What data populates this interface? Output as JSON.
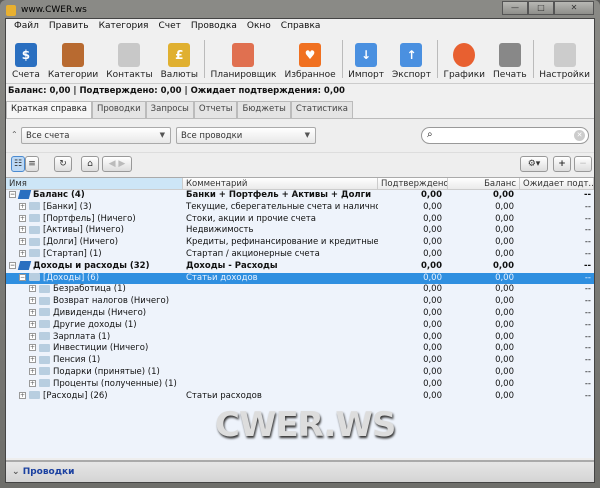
{
  "window": {
    "title": "www.CWER.ws",
    "controls": [
      "—",
      "□",
      "✕"
    ]
  },
  "menu": [
    "Файл",
    "Править",
    "Категория",
    "Счет",
    "Проводка",
    "Окно",
    "Справка"
  ],
  "toolbar": [
    {
      "label": "Счета",
      "icon": "accounts-icon",
      "color": "#2a6fc0",
      "glyph": "$"
    },
    {
      "label": "Категории",
      "icon": "categories-icon",
      "color": "#b86a30",
      "glyph": ""
    },
    {
      "label": "Контакты",
      "icon": "contacts-icon",
      "color": "#c8c8c8",
      "glyph": ""
    },
    {
      "label": "Валюты",
      "icon": "currencies-icon",
      "color": "#e0b030",
      "glyph": "£"
    },
    {
      "label": "Планировщик",
      "icon": "scheduler-icon",
      "color": "#e07050",
      "glyph": ""
    },
    {
      "label": "Избранное",
      "icon": "favorites-heart-icon",
      "color": "#f07020",
      "glyph": "♥"
    },
    {
      "label": "Импорт",
      "icon": "import-icon",
      "color": "#4a90e0",
      "glyph": "↓"
    },
    {
      "label": "Экспорт",
      "icon": "export-icon",
      "color": "#4a90e0",
      "glyph": "↑"
    },
    {
      "label": "Графики",
      "icon": "charts-pie-icon",
      "color": "#e86030",
      "glyph": ""
    },
    {
      "label": "Печать",
      "icon": "print-icon",
      "color": "#888888",
      "glyph": ""
    },
    {
      "label": "Настройки",
      "icon": "settings-switch-icon",
      "color": "#cccccc",
      "glyph": ""
    }
  ],
  "status": "Баланс: 0,00 | Подтверждено: 0,00 | Ожидает подтверждения: 0,00",
  "tabs": [
    "Краткая справка",
    "Проводки",
    "Запросы",
    "Отчеты",
    "Бюджеты",
    "Статистика"
  ],
  "filters": {
    "accounts": "Все счета",
    "transactions": "Все проводки",
    "search_placeholder": ""
  },
  "columns": [
    "Имя",
    "Комментарий",
    "Подтверждено",
    "Баланс",
    "Ожидает подт..."
  ],
  "rows": [
    {
      "name": "Баланс (4)",
      "comment": "Банки + Портфель + Активы + Долги",
      "cleared": "0,00",
      "balance": "0,00",
      "pending": "--",
      "level": 0,
      "type": "book",
      "bold": true,
      "exp": "−"
    },
    {
      "name": "[Банки] (3)",
      "comment": "Текущие, сберегательные счета и наличность",
      "cleared": "0,00",
      "balance": "0,00",
      "pending": "--",
      "level": 1,
      "type": "folder",
      "exp": "+"
    },
    {
      "name": "[Портфель] (Ничего)",
      "comment": "Стоки, акции и прочие счета",
      "cleared": "0,00",
      "balance": "0,00",
      "pending": "--",
      "level": 1,
      "type": "folder",
      "exp": "+"
    },
    {
      "name": "[Активы] (Ничего)",
      "comment": "Недвижимость",
      "cleared": "0,00",
      "balance": "0,00",
      "pending": "--",
      "level": 1,
      "type": "folder",
      "exp": "+"
    },
    {
      "name": "[Долги] (Ничего)",
      "comment": "Кредиты, рефинансирование и кредитные ка...",
      "cleared": "0,00",
      "balance": "0,00",
      "pending": "--",
      "level": 1,
      "type": "folder",
      "exp": "+"
    },
    {
      "name": "[Стартап] (1)",
      "comment": "Стартап / акционерные счета",
      "cleared": "0,00",
      "balance": "0,00",
      "pending": "--",
      "level": 1,
      "type": "folder",
      "exp": "+"
    },
    {
      "name": "Доходы и расходы (32)",
      "comment": "Доходы - Расходы",
      "cleared": "0,00",
      "balance": "0,00",
      "pending": "--",
      "level": 0,
      "type": "book",
      "bold": true,
      "exp": "−"
    },
    {
      "name": "[Доходы] (6)",
      "comment": "Статьи доходов",
      "cleared": "0,00",
      "balance": "0,00",
      "pending": "--",
      "level": 1,
      "type": "folder",
      "selected": true,
      "exp": "−"
    },
    {
      "name": "Безработица (1)",
      "comment": "",
      "cleared": "0,00",
      "balance": "0,00",
      "pending": "--",
      "level": 2,
      "type": "folder",
      "exp": "+"
    },
    {
      "name": "Возврат налогов (Ничего)",
      "comment": "",
      "cleared": "0,00",
      "balance": "0,00",
      "pending": "--",
      "level": 2,
      "type": "folder",
      "exp": "+"
    },
    {
      "name": "Дивиденды (Ничего)",
      "comment": "",
      "cleared": "0,00",
      "balance": "0,00",
      "pending": "--",
      "level": 2,
      "type": "folder",
      "exp": "+"
    },
    {
      "name": "Другие доходы (1)",
      "comment": "",
      "cleared": "0,00",
      "balance": "0,00",
      "pending": "--",
      "level": 2,
      "type": "folder",
      "exp": "+"
    },
    {
      "name": "Зарплата (1)",
      "comment": "",
      "cleared": "0,00",
      "balance": "0,00",
      "pending": "--",
      "level": 2,
      "type": "folder",
      "exp": "+"
    },
    {
      "name": "Инвестиции (Ничего)",
      "comment": "",
      "cleared": "0,00",
      "balance": "0,00",
      "pending": "--",
      "level": 2,
      "type": "folder",
      "exp": "+"
    },
    {
      "name": "Пенсия (1)",
      "comment": "",
      "cleared": "0,00",
      "balance": "0,00",
      "pending": "--",
      "level": 2,
      "type": "folder",
      "exp": "+"
    },
    {
      "name": "Подарки (принятые) (1)",
      "comment": "",
      "cleared": "0,00",
      "balance": "0,00",
      "pending": "--",
      "level": 2,
      "type": "folder",
      "exp": "+"
    },
    {
      "name": "Проценты (полученные) (1)",
      "comment": "",
      "cleared": "0,00",
      "balance": "0,00",
      "pending": "--",
      "level": 2,
      "type": "folder",
      "exp": "+"
    },
    {
      "name": "[Расходы] (26)",
      "comment": "Статьи расходов",
      "cleared": "0,00",
      "balance": "0,00",
      "pending": "--",
      "level": 1,
      "type": "folder",
      "exp": "+"
    }
  ],
  "watermark": "CWER.WS",
  "bottom_panel": "Проводки"
}
